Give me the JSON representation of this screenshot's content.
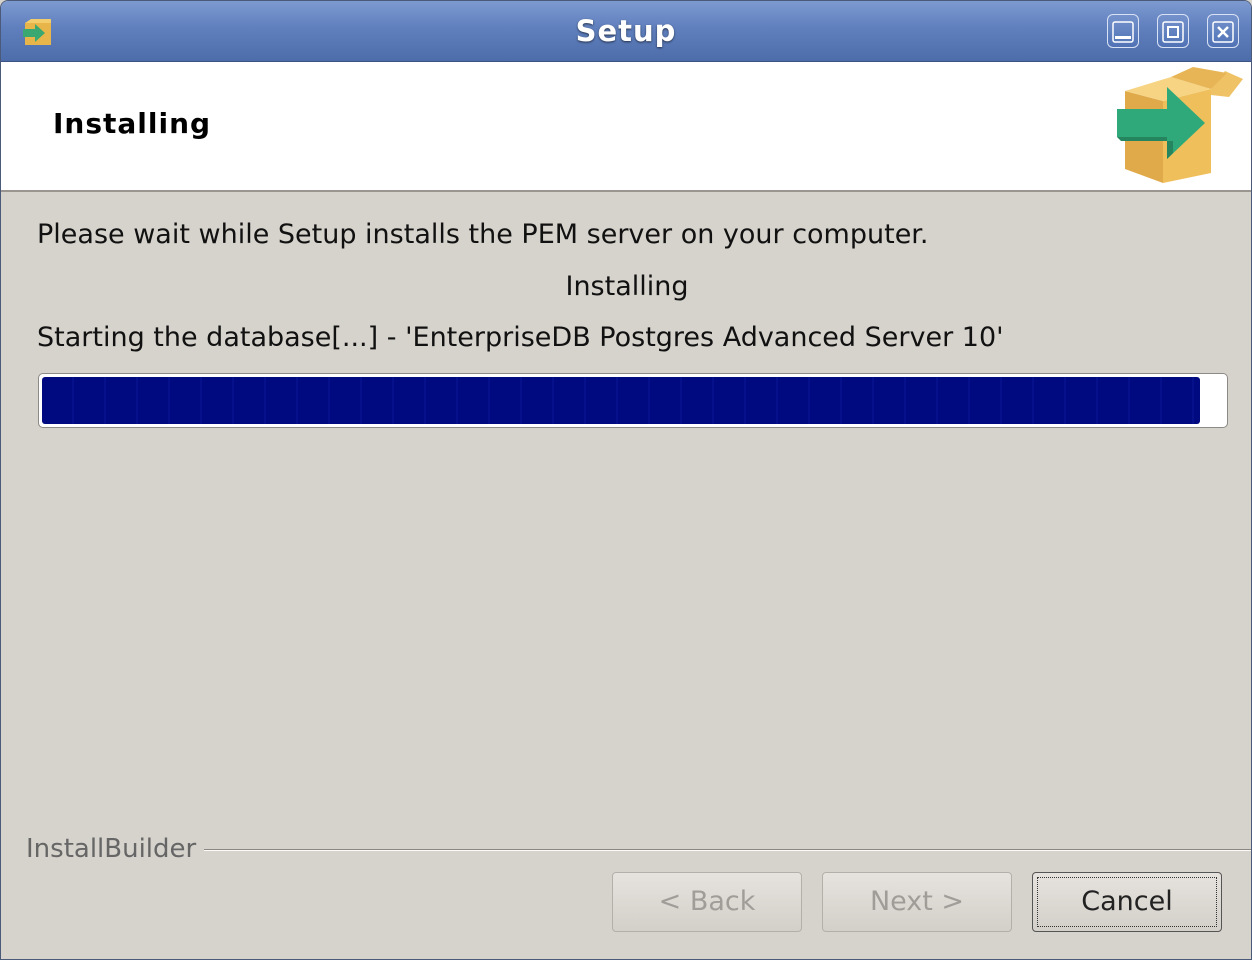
{
  "window": {
    "title": "Setup"
  },
  "header": {
    "title": "Installing"
  },
  "content": {
    "intro": "Please wait while Setup installs the PEM server on your computer.",
    "status": "Installing",
    "detail": "Starting the database[...] - 'EnterpriseDB Postgres Advanced Server 10'",
    "progress": 0.98
  },
  "footer": {
    "brand": "InstallBuilder",
    "back_label": "< Back",
    "next_label": "Next >",
    "cancel_label": "Cancel"
  },
  "colors": {
    "progress_fill": "#000a80",
    "titlebar": "#5f7fbd"
  }
}
